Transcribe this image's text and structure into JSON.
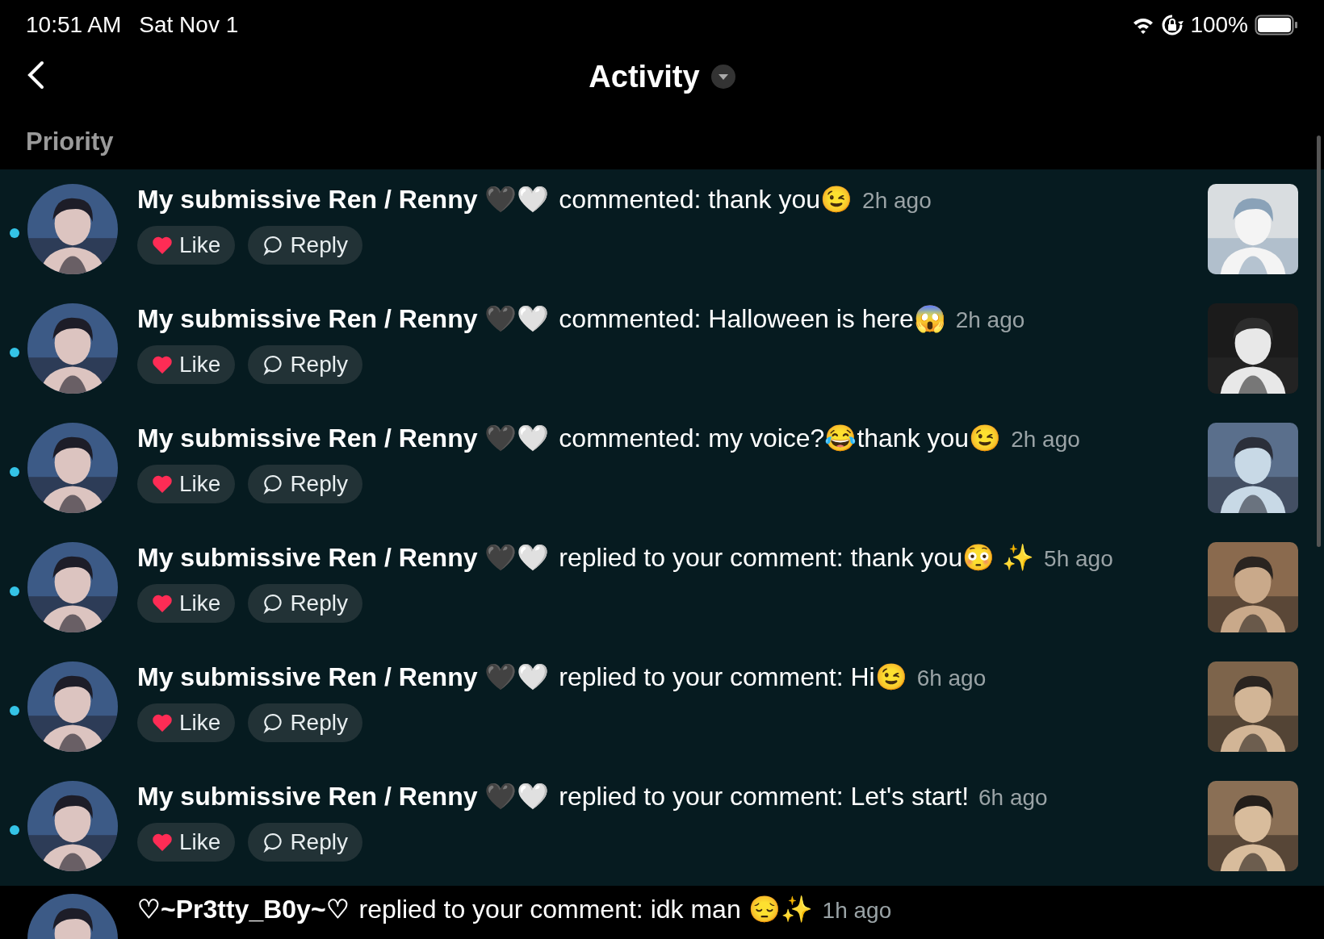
{
  "status_bar": {
    "time": "10:51 AM",
    "date": "Sat Nov 1",
    "battery": "100%"
  },
  "header": {
    "title": "Activity"
  },
  "sections": [
    {
      "title": "Priority",
      "items": [
        {
          "name": "My submissive Ren / Renny 🖤🤍",
          "message": "commented: thank you😉",
          "time": "2h ago",
          "unread": true,
          "like": "Like",
          "reply": "Reply"
        },
        {
          "name": "My submissive Ren / Renny 🖤🤍",
          "message": "commented: Halloween is here😱",
          "time": "2h ago",
          "unread": true,
          "like": "Like",
          "reply": "Reply"
        },
        {
          "name": "My submissive Ren / Renny 🖤🤍",
          "message": "commented: my voice?😂thank you😉",
          "time": "2h ago",
          "unread": true,
          "like": "Like",
          "reply": "Reply"
        },
        {
          "name": "My submissive Ren / Renny 🖤🤍",
          "message": "replied to your comment: thank you😳 ✨",
          "time": "5h ago",
          "unread": true,
          "like": "Like",
          "reply": "Reply"
        },
        {
          "name": "My submissive Ren / Renny 🖤🤍",
          "message": "replied to your comment: Hi😉",
          "time": "6h ago",
          "unread": true,
          "like": "Like",
          "reply": "Reply"
        },
        {
          "name": "My submissive Ren / Renny 🖤🤍",
          "message": "replied to your comment: Let's start!",
          "time": "6h ago",
          "unread": true,
          "like": "Like",
          "reply": "Reply"
        }
      ]
    },
    {
      "items": [
        {
          "name": "♡~Pr3tty_B0y~♡",
          "message": "replied to your comment: idk man 😔✨",
          "time": "1h ago"
        }
      ]
    }
  ]
}
